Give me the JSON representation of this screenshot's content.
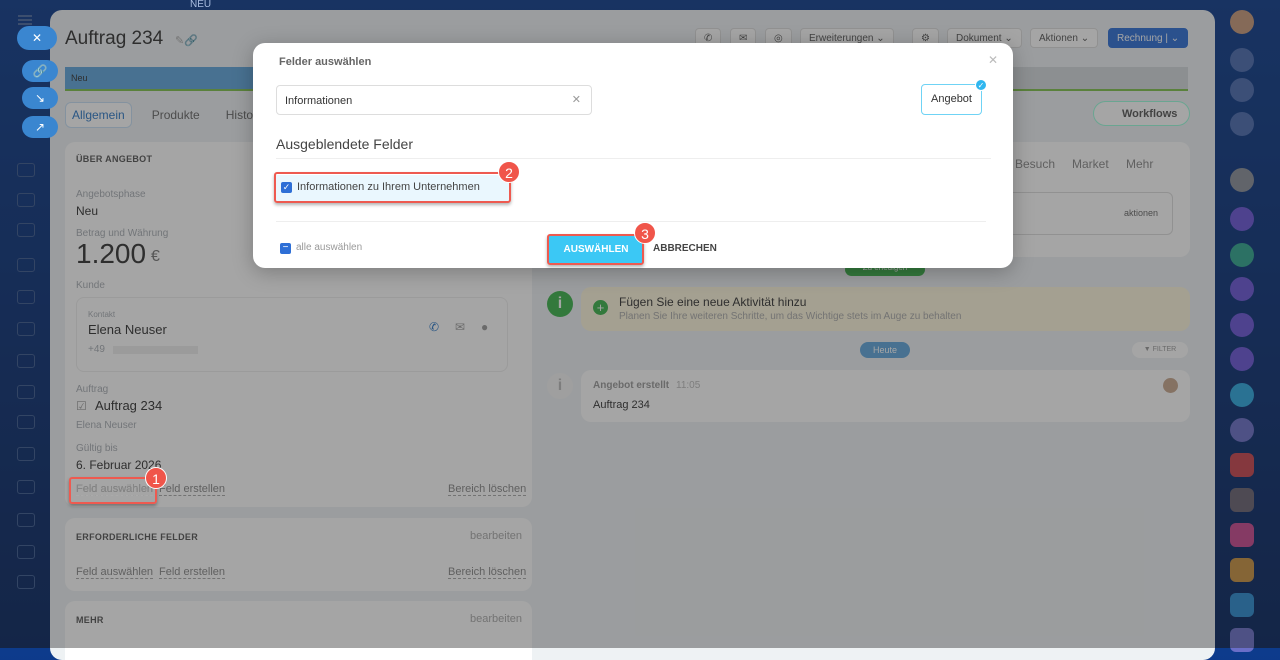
{
  "header": {
    "title": "Auftrag 234",
    "top_label": "NEU",
    "buttons": {
      "extensions": "Erweiterungen",
      "document": "Dokument",
      "actions": "Aktionen",
      "invoice": "Rechnung"
    }
  },
  "pipeline": {
    "stage": "Neu"
  },
  "tabs": [
    "Allgemein",
    "Produkte",
    "History"
  ],
  "workflows_label": "Workflows",
  "right_tabs": [
    "Besuch",
    "Market",
    "Mehr"
  ],
  "right_actions": "aktionen",
  "about": {
    "title": "ÜBER ANGEBOT",
    "phase_label": "Angebotsphase",
    "phase": "Neu",
    "amount_label": "Betrag und Währung",
    "amount": "1.200",
    "currency": "€",
    "customer_label": "Kunde",
    "contact_label": "Kontakt",
    "contact_name": "Elena Neuser",
    "phone": "+49",
    "order_label": "Auftrag",
    "order": "Auftrag 234",
    "order_sub": "Elena Neuser",
    "valid_label": "Gültig bis",
    "valid": "6. Februar 2026",
    "select_field": "Feld auswählen",
    "create_field": "Feld erstellen",
    "delete_section": "Bereich löschen"
  },
  "required": {
    "title": "ERFORDERLICHE FELDER",
    "edit": "bearbeiten",
    "select_field": "Feld auswählen",
    "create_field": "Feld erstellen",
    "delete_section": "Bereich löschen"
  },
  "more": {
    "title": "MEHR",
    "edit": "bearbeiten"
  },
  "timeline": {
    "todo_badge": "Zu erledigen",
    "add_title": "Fügen Sie eine neue Aktivität hinzu",
    "add_sub": "Planen Sie Ihre weiteren Schritte, um das Wichtige stets im Auge zu behalten",
    "today": "Heute",
    "filter": "FILTER",
    "event_title": "Angebot erstellt",
    "event_time": "11:05",
    "event_body": "Auftrag 234"
  },
  "modal": {
    "title": "Felder auswählen",
    "search_value": "Informationen",
    "entity_chip": "Angebot",
    "section_title": "Ausgeblendete Felder",
    "field": "Informationen zu Ihrem Unternehmen",
    "field_checked": true,
    "select_all": "alle auswählen",
    "confirm": "AUSWÄHLEN",
    "cancel": "ABBRECHEN"
  },
  "annotations": [
    "1",
    "2",
    "3"
  ],
  "colors": {
    "accent": "#3bc8f5",
    "annotation": "#f0554a",
    "primary": "#2b77c6"
  }
}
